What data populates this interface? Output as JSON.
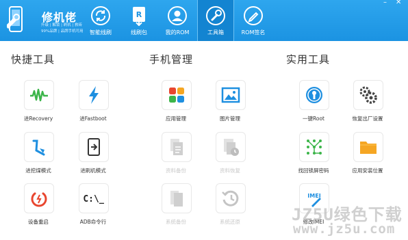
{
  "app": {
    "title": "修机佬",
    "subtitle_line1": "升级 | 解锁 | 刷机 | 救砖",
    "subtitle_line2": "99%品牌 | 品牌手机可用"
  },
  "nav": [
    {
      "label": "智能线刷",
      "icon": "refresh-icon",
      "active": false
    },
    {
      "label": "线刷包",
      "icon": "download-package-icon",
      "active": false
    },
    {
      "label": "我的ROM",
      "icon": "user-icon",
      "active": false
    },
    {
      "label": "工具箱",
      "icon": "wrench-icon",
      "active": true
    },
    {
      "label": "ROM签名",
      "icon": "pen-icon",
      "active": false
    }
  ],
  "window_controls": {
    "minimize": "–",
    "close": "✕"
  },
  "sections": {
    "quick": {
      "title": "快捷工具",
      "items": [
        {
          "label": "进Recovery",
          "icon": "waveform-icon"
        },
        {
          "label": "进Fastboot",
          "icon": "lightning-icon"
        },
        {
          "label": "进挖煤模式",
          "icon": "shovel-icon"
        },
        {
          "label": "进刷机模式",
          "icon": "phone-flash-icon"
        },
        {
          "label": "设备重启",
          "icon": "restart-icon"
        },
        {
          "label": "ADB命令行",
          "icon": "terminal-icon",
          "glyph": "C:\\_"
        }
      ]
    },
    "phone": {
      "title": "手机管理",
      "items": [
        {
          "label": "应用管理",
          "icon": "apps-grid-icon",
          "disabled": false
        },
        {
          "label": "图片管理",
          "icon": "image-icon",
          "disabled": false
        },
        {
          "label": "资料备份",
          "icon": "document-backup-icon",
          "disabled": true
        },
        {
          "label": "资料恢复",
          "icon": "document-restore-icon",
          "disabled": true
        },
        {
          "label": "系统备份",
          "icon": "system-backup-icon",
          "disabled": true
        },
        {
          "label": "系统还原",
          "icon": "history-icon",
          "disabled": true
        }
      ]
    },
    "utility": {
      "title": "实用工具",
      "items": [
        {
          "label": "一键Root",
          "icon": "keyhole-icon"
        },
        {
          "label": "恢复出厂设置",
          "icon": "gears-icon"
        },
        {
          "label": "找回锁屏密码",
          "icon": "pattern-lock-icon"
        },
        {
          "label": "应用安装位置",
          "icon": "folder-icon"
        },
        {
          "label": "修改IMEI",
          "icon": "imei-edit-icon",
          "glyph": "IMEI"
        }
      ]
    }
  },
  "watermark": {
    "line1": "JZ5U绿色下载",
    "line2": "www.jz5u.com"
  },
  "colors": {
    "header": "#1b93e2",
    "header_active": "#1384d1",
    "green": "#3cb54a",
    "blue": "#1e8fe0",
    "red": "#e8462f",
    "orange": "#f5a623",
    "disabled": "#d0d0d0"
  }
}
